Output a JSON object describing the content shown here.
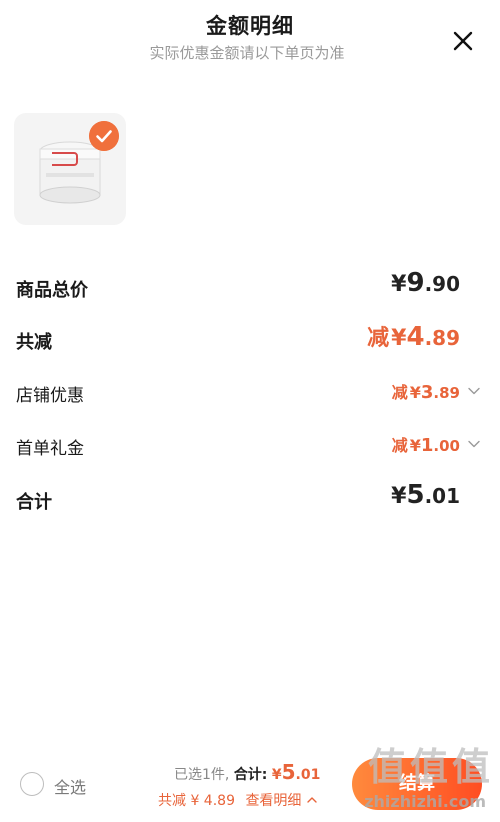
{
  "header": {
    "title": "金额明细",
    "subtitle": "实际优惠金额请以下单页为准",
    "close_icon": "close-icon"
  },
  "product": {
    "image_icon": "product-image-icon",
    "selected": true,
    "check_color": "#f0703c"
  },
  "rows": {
    "total_price": {
      "label": "商品总价",
      "currency": "¥",
      "int": "9",
      "dec": ".90"
    },
    "total_discount": {
      "label": "共减",
      "prefix": "减",
      "currency": "¥",
      "int": "4",
      "dec": ".89"
    },
    "shop_discount": {
      "label": "店铺优惠",
      "prefix": "减",
      "currency": "¥",
      "int": "3",
      "dec": ".89"
    },
    "first_order_gift": {
      "label": "首单礼金",
      "prefix": "减",
      "currency": "¥",
      "int": "1",
      "dec": ".00"
    },
    "sum": {
      "label": "合计",
      "currency": "¥",
      "int": "5",
      "dec": ".01"
    }
  },
  "bottom_bar": {
    "select_all": "全选",
    "selected_count": "已选1件,",
    "total_label": "合计:",
    "currency": "¥",
    "amount_int": "5",
    "amount_dec": ".01",
    "discount_text": "共减 ¥ 4.89",
    "view_detail": "查看明细",
    "checkout_label": "结算"
  },
  "watermark": {
    "text": "值值值",
    "url": "zhizhizhi.com"
  },
  "colors": {
    "accent": "#e8643a",
    "checkout_start": "#ff8a3d",
    "checkout_end": "#ff4d22"
  }
}
